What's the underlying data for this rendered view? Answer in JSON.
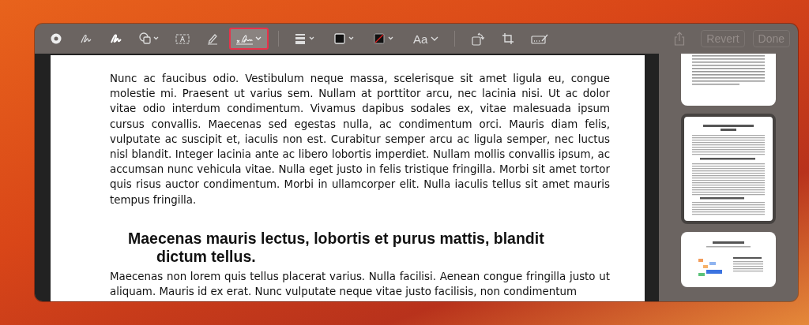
{
  "toolbar": {
    "tool_groups": [
      [
        {
          "kind": "record",
          "selected": false
        },
        {
          "kind": "sketch",
          "selected": false
        },
        {
          "kind": "draw",
          "selected": false
        },
        {
          "kind": "shapes",
          "selected": false
        },
        {
          "kind": "textbox",
          "selected": false
        },
        {
          "kind": "highlight",
          "selected": false
        },
        {
          "kind": "signature",
          "selected": true
        }
      ],
      [
        {
          "kind": "line-style",
          "selected": false
        },
        {
          "kind": "border-color",
          "selected": false
        },
        {
          "kind": "fill-color",
          "selected": false
        },
        {
          "kind": "text-style",
          "label": "Aa",
          "selected": false
        }
      ],
      [
        {
          "kind": "rotate",
          "selected": false
        },
        {
          "kind": "crop",
          "selected": false
        },
        {
          "kind": "form",
          "selected": false
        }
      ]
    ],
    "share": {
      "disabled": true
    },
    "buttons": [
      {
        "label": "Revert",
        "disabled": true
      },
      {
        "label": "Done",
        "disabled": true
      }
    ]
  },
  "document": {
    "blocks": [
      {
        "kind": "paragraph",
        "text": "Nunc ac faucibus odio. Vestibulum neque massa, scelerisque sit amet ligula eu, congue molestie mi. Praesent ut varius sem. Nullam at porttitor arcu, nec lacinia nisi. Ut ac dolor vitae odio interdum condimentum. Vivamus dapibus sodales ex, vitae malesuada ipsum cursus convallis. Maecenas sed egestas nulla, ac condimentum orci. Mauris diam felis, vulputate ac suscipit et, iaculis non est. Curabitur semper arcu ac ligula semper, nec luctus nisl blandit. Integer lacinia ante ac libero lobortis imperdiet. Nullam mollis convallis ipsum, ac accumsan nunc vehicula vitae. Nulla eget justo in felis tristique fringilla. Morbi sit amet tortor quis risus auctor condimentum. Morbi in ullamcorper elit. Nulla iaculis tellus sit amet mauris tempus fringilla."
      },
      {
        "kind": "heading",
        "text": "Maecenas mauris lectus, lobortis et purus mattis, blandit dictum tellus."
      },
      {
        "kind": "paragraph",
        "text": "Maecenas non lorem quis tellus placerat varius. Nulla facilisi. Aenean congue fringilla justo ut aliquam. Mauris id ex erat. Nunc vulputate neque vitae justo facilisis, non condimentum"
      }
    ]
  },
  "thumbnails": [
    {
      "selected": false
    },
    {
      "selected": true
    },
    {
      "selected": false
    }
  ]
}
